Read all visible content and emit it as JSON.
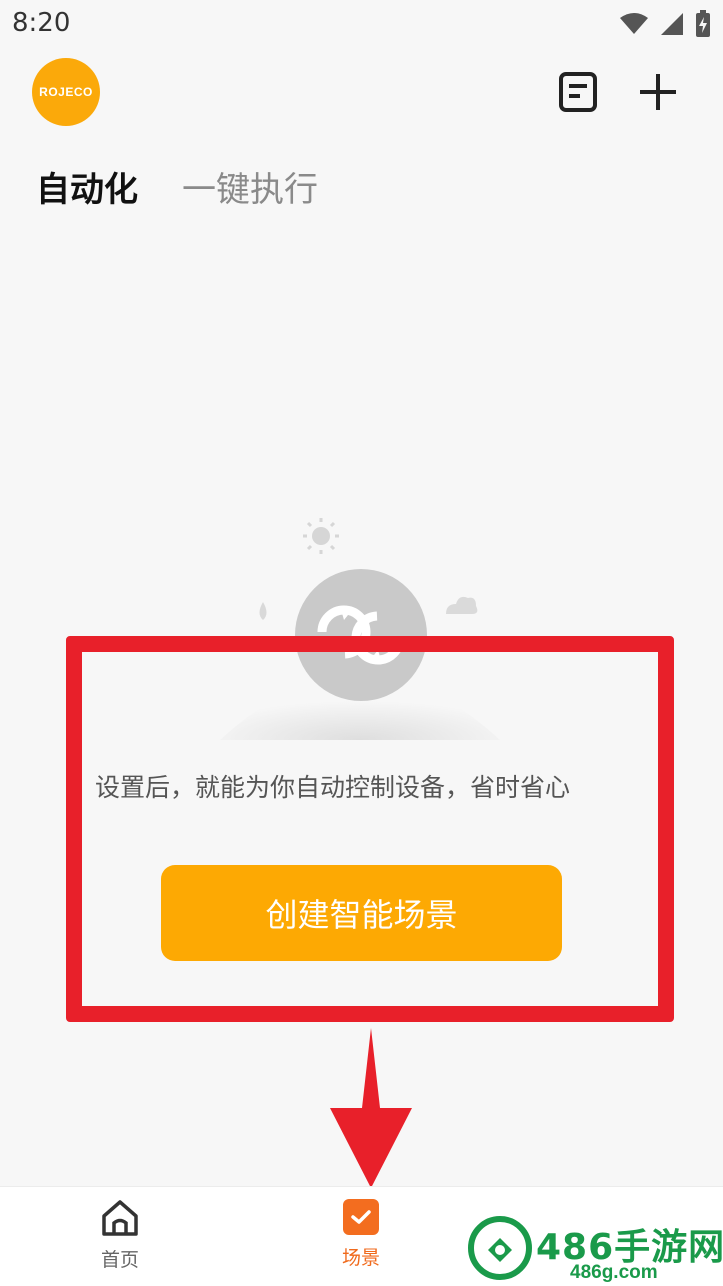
{
  "status_bar": {
    "time": "8:20",
    "icons": [
      "wifi-icon",
      "signal-icon",
      "battery-charging-icon"
    ]
  },
  "header": {
    "logo_text": "ROJECO",
    "actions": [
      "log-icon",
      "add-icon"
    ]
  },
  "tabs": [
    {
      "label": "自动化",
      "active": true
    },
    {
      "label": "一键执行",
      "active": false
    }
  ],
  "empty_state": {
    "illustration": "automation-loop-illustration",
    "message": "设置后，就能为你自动控制设备，省时省心",
    "button_label": "创建智能场景"
  },
  "bottom_nav": [
    {
      "label": "首页",
      "icon": "home-icon",
      "active": false
    },
    {
      "label": "场景",
      "icon": "scene-check-icon",
      "active": true
    }
  ],
  "watermark": {
    "title": "486手游网",
    "url": "486g.com"
  },
  "colors": {
    "brand": "#fba90a",
    "button": "#fda903",
    "nav_active": "#f06a1c",
    "annotation": "#e8202a",
    "watermark": "#1a9a4a"
  }
}
